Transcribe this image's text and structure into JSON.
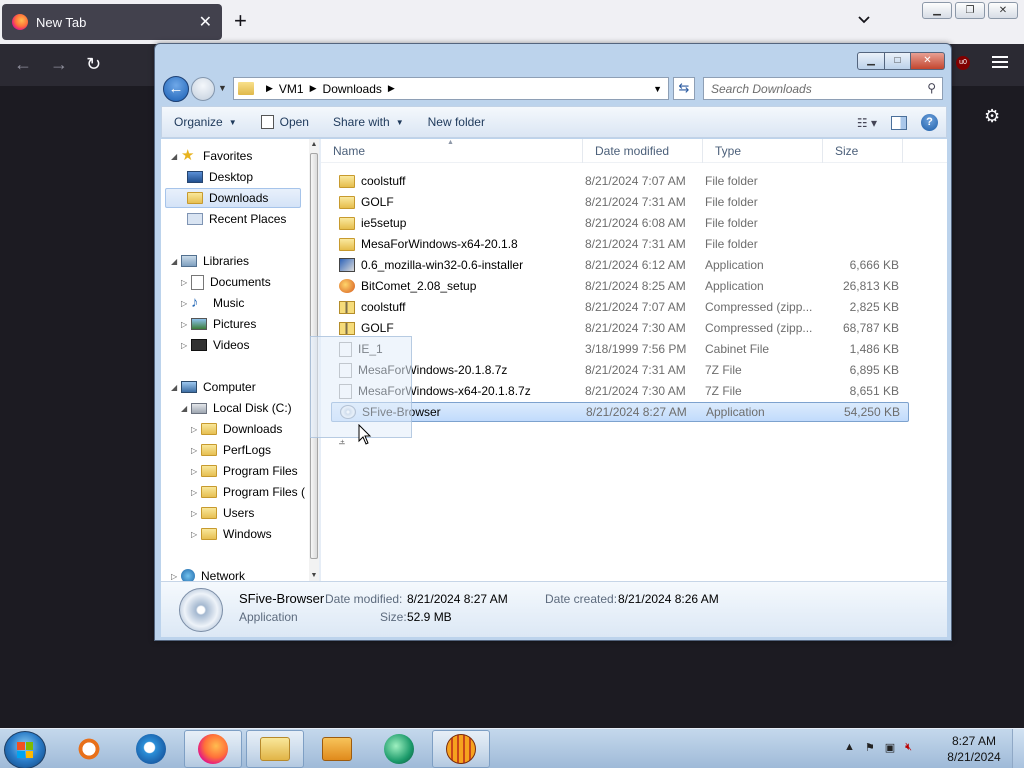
{
  "browser": {
    "tab_title": "New Tab",
    "tab_close": "✕",
    "new_tab": "+",
    "win_min": "▁",
    "win_max": "❐",
    "win_close": "✕",
    "ublock_badge": "u0"
  },
  "explorer": {
    "caption": {
      "min": "▁",
      "max": "□",
      "close": "✕"
    },
    "address": {
      "segments": [
        "VM1",
        "Downloads"
      ],
      "search_placeholder": "Search Downloads"
    },
    "commands": {
      "organize": "Organize",
      "open": "Open",
      "share_with": "Share with",
      "new_folder": "New folder"
    },
    "nav": {
      "favorites": "Favorites",
      "desktop": "Desktop",
      "downloads": "Downloads",
      "recent_places": "Recent Places",
      "libraries": "Libraries",
      "documents": "Documents",
      "music": "Music",
      "pictures": "Pictures",
      "videos": "Videos",
      "computer": "Computer",
      "local_disk": "Local Disk (C:)",
      "c_downloads": "Downloads",
      "perflogs": "PerfLogs",
      "program_files": "Program Files",
      "program_files_x86": "Program Files (",
      "users": "Users",
      "windows": "Windows",
      "network": "Network"
    },
    "columns": {
      "name": "Name",
      "date": "Date modified",
      "type": "Type",
      "size": "Size"
    },
    "files": [
      {
        "name": "coolstuff",
        "date": "8/21/2024 7:07 AM",
        "type": "File folder",
        "size": "",
        "icon": "folder"
      },
      {
        "name": "GOLF",
        "date": "8/21/2024 7:31 AM",
        "type": "File folder",
        "size": "",
        "icon": "folder"
      },
      {
        "name": "ie5setup",
        "date": "8/21/2024 6:08 AM",
        "type": "File folder",
        "size": "",
        "icon": "folder"
      },
      {
        "name": "MesaForWindows-x64-20.1.8",
        "date": "8/21/2024 7:31 AM",
        "type": "File folder",
        "size": "",
        "icon": "folder"
      },
      {
        "name": "0.6_mozilla-win32-0.6-installer",
        "date": "8/21/2024 6:12 AM",
        "type": "Application",
        "size": "6,666 KB",
        "icon": "app"
      },
      {
        "name": "BitComet_2.08_setup",
        "date": "8/21/2024 8:25 AM",
        "type": "Application",
        "size": "26,813 KB",
        "icon": "comet"
      },
      {
        "name": "coolstuff",
        "date": "8/21/2024 7:07 AM",
        "type": "Compressed (zipp...",
        "size": "2,825 KB",
        "icon": "zip"
      },
      {
        "name": "GOLF",
        "date": "8/21/2024 7:30 AM",
        "type": "Compressed (zipp...",
        "size": "68,787 KB",
        "icon": "zip"
      },
      {
        "name": "IE_1",
        "date": "3/18/1999 7:56 PM",
        "type": "Cabinet File",
        "size": "1,486 KB",
        "icon": "blank"
      },
      {
        "name": "MesaForWindows-20.1.8.7z",
        "date": "8/21/2024 7:31 AM",
        "type": "7Z File",
        "size": "6,895 KB",
        "icon": "blank"
      },
      {
        "name": "MesaForWindows-x64-20.1.8.7z",
        "date": "8/21/2024 7:30 AM",
        "type": "7Z File",
        "size": "8,651 KB",
        "icon": "blank"
      },
      {
        "name": "SFive-Browser",
        "date": "8/21/2024 8:27 AM",
        "type": "Application",
        "size": "54,250 KB",
        "icon": "disc"
      }
    ],
    "details": {
      "name": "SFive-Browser",
      "kind": "Application",
      "date_modified_label": "Date modified:",
      "date_modified": "8/21/2024 8:27 AM",
      "date_created_label": "Date created:",
      "date_created": "8/21/2024 8:26 AM",
      "size_label": "Size:",
      "size": "52.9 MB"
    }
  },
  "taskbar": {
    "time": "8:27 AM",
    "date": "8/21/2024"
  }
}
